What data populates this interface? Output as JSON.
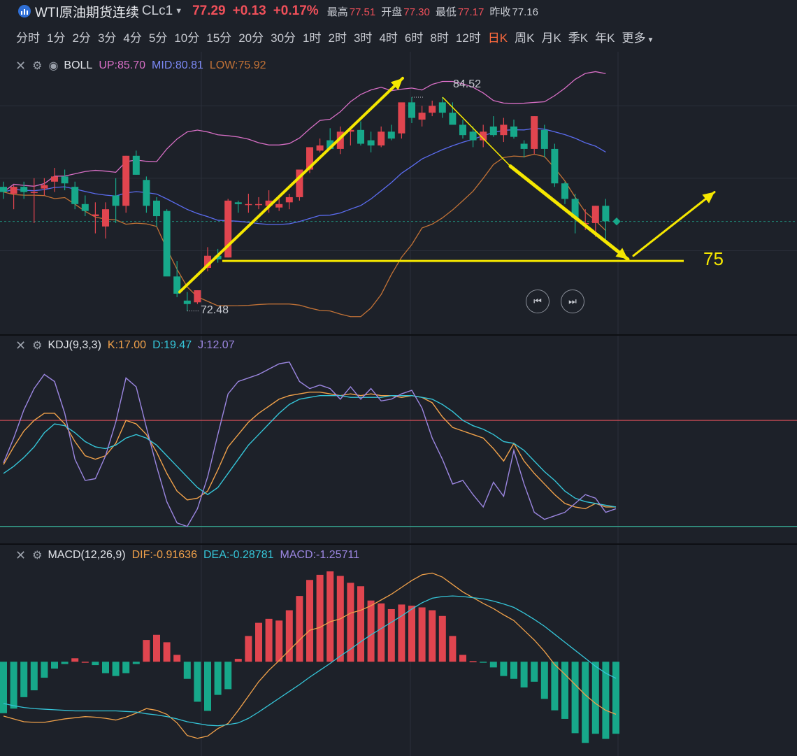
{
  "header": {
    "symbol": "WTI原油期货连续",
    "code": "CLc1",
    "price": "77.29",
    "change": "+0.13",
    "change_pct": "+0.17%",
    "stats": [
      {
        "label": "最高",
        "value": "77.51",
        "color": "red"
      },
      {
        "label": "开盘",
        "value": "77.30",
        "color": "red"
      },
      {
        "label": "最低",
        "value": "77.17",
        "color": "red"
      },
      {
        "label": "昨收",
        "value": "77.16",
        "color": "gray"
      }
    ]
  },
  "periods": [
    "分时",
    "1分",
    "2分",
    "3分",
    "4分",
    "5分",
    "10分",
    "15分",
    "20分",
    "30分",
    "1时",
    "2时",
    "3时",
    "4时",
    "6时",
    "8时",
    "12时",
    "日K",
    "周K",
    "月K",
    "季K",
    "年K",
    "更多"
  ],
  "active_period": "日K",
  "indicators": {
    "boll": {
      "name": "BOLL",
      "up": "UP:85.70",
      "mid": "MID:80.81",
      "low": "LOW:75.92"
    },
    "kdj": {
      "name": "KDJ(9,3,3)",
      "k": "K:17.00",
      "d": "D:19.47",
      "j": "J:12.07"
    },
    "macd": {
      "name": "MACD(12,26,9)",
      "dif": "DIF:-0.91636",
      "dea": "DEA:-0.28781",
      "macd": "MACD:-1.25711"
    }
  },
  "annotations": {
    "high_label": "84.52",
    "low_label": "72.48",
    "support_label": "75"
  },
  "colors": {
    "up": "#e0454f",
    "down": "#17a88a",
    "boll_up": "#d86fc6",
    "boll_mid": "#5b6cf0",
    "boll_low": "#c27236",
    "k": "#f0a14a",
    "d": "#35c5d8",
    "j": "#9b86e0",
    "arrow": "#f5e700"
  },
  "chart_data": [
    {
      "type": "candlestick",
      "title": "",
      "series": [
        {
          "name": "BOLL",
          "values": [
            [
              79.3,
              79.6,
              78.6,
              79.0
            ],
            [
              78.9,
              79.4,
              78.0,
              79.3
            ],
            [
              79.3,
              79.6,
              78.6,
              79.0
            ],
            [
              79.0,
              79.8,
              77.2,
              79.0
            ],
            [
              79.2,
              79.8,
              78.8,
              79.4
            ],
            [
              79.6,
              80.4,
              79.0,
              79.9
            ],
            [
              79.9,
              80.3,
              79.1,
              79.5
            ],
            [
              79.3,
              79.6,
              78.0,
              78.3
            ],
            [
              78.3,
              78.8,
              77.6,
              77.9
            ],
            [
              77.6,
              78.4,
              76.6,
              77.7
            ],
            [
              77.0,
              78.4,
              76.3,
              78.0
            ],
            [
              78.8,
              79.8,
              77.2,
              78.2
            ],
            [
              78.2,
              81.1,
              77.8,
              81.1
            ],
            [
              81.1,
              81.4,
              80.0,
              80.0
            ],
            [
              79.7,
              79.9,
              77.8,
              78.2
            ],
            [
              78.5,
              78.7,
              77.0,
              77.6
            ],
            [
              77.9,
              78.0,
              74.8,
              74.1
            ],
            [
              74.1,
              75.0,
              72.9,
              73.1
            ],
            [
              72.7,
              73.2,
              72.1,
              72.5
            ],
            [
              72.6,
              73.3,
              72.5,
              73.3
            ],
            [
              74.6,
              75.8,
              74.4,
              75.3
            ],
            [
              75.3,
              75.7,
              74.9,
              75.1
            ],
            [
              75.2,
              78.6,
              75.2,
              78.5
            ],
            [
              78.4,
              78.5,
              77.8,
              78.3
            ],
            [
              78.3,
              78.9,
              77.8,
              78.3
            ],
            [
              78.3,
              78.7,
              78.0,
              78.3
            ],
            [
              78.2,
              79.1,
              77.8,
              78.5
            ],
            [
              78.1,
              78.6,
              77.9,
              78.3
            ],
            [
              78.4,
              78.9,
              78.0,
              78.7
            ],
            [
              78.7,
              80.3,
              78.5,
              80.3
            ],
            [
              80.3,
              81.6,
              80.1,
              81.6
            ],
            [
              81.4,
              82.1,
              81.3,
              81.7
            ],
            [
              82.0,
              82.7,
              81.5,
              81.5
            ],
            [
              81.5,
              82.8,
              81.2,
              82.5
            ],
            [
              82.5,
              82.8,
              81.7,
              82.6
            ],
            [
              82.6,
              83.1,
              81.7,
              81.8
            ],
            [
              82.0,
              82.5,
              81.3,
              81.7
            ],
            [
              81.7,
              82.8,
              81.6,
              82.5
            ],
            [
              82.5,
              82.9,
              82.0,
              82.1
            ],
            [
              82.4,
              83.5,
              82.1,
              84.2
            ],
            [
              84.2,
              84.5,
              83.0,
              83.3
            ],
            [
              83.2,
              84.0,
              82.8,
              83.6
            ],
            [
              83.6,
              84.3,
              83.4,
              84.0
            ],
            [
              84.2,
              84.5,
              83.3,
              83.6
            ],
            [
              83.6,
              84.2,
              83.0,
              82.9
            ],
            [
              82.9,
              83.2,
              82.1,
              82.3
            ],
            [
              82.5,
              82.8,
              81.6,
              82.0
            ],
            [
              82.0,
              82.9,
              81.6,
              82.5
            ],
            [
              82.8,
              83.4,
              82.2,
              82.3
            ],
            [
              82.3,
              83.3,
              81.9,
              82.9
            ],
            [
              82.8,
              83.2,
              82.1,
              82.2
            ],
            [
              81.8,
              82.0,
              81.0,
              81.5
            ],
            [
              81.5,
              83.4,
              81.2,
              83.4
            ],
            [
              82.6,
              82.9,
              81.0,
              81.5
            ],
            [
              81.5,
              81.8,
              79.3,
              79.5
            ],
            [
              79.5,
              79.6,
              78.3,
              78.6
            ],
            [
              78.6,
              78.9,
              76.6,
              77.5
            ],
            [
              77.2,
              78.0,
              76.8,
              77.2
            ],
            [
              77.2,
              78.2,
              76.4,
              78.2
            ],
            [
              78.2,
              78.6,
              76.2,
              77.3
            ]
          ]
        }
      ],
      "ylim": [
        71.8,
        86.0
      ],
      "ylabel": "",
      "xlabel": ""
    },
    {
      "type": "line",
      "title": "",
      "series": [
        {
          "name": "K",
          "values": [
            55,
            65,
            74,
            80,
            84,
            84,
            78,
            68,
            60,
            58,
            60,
            67,
            80,
            78,
            72,
            62,
            50,
            40,
            35,
            36,
            40,
            52,
            65,
            72,
            79,
            84,
            88,
            92,
            94,
            95,
            96,
            96,
            95,
            94,
            95,
            94,
            95,
            94,
            94,
            93,
            94,
            93,
            90,
            82,
            76,
            74,
            72,
            70,
            64,
            57,
            67,
            57,
            50,
            44,
            38,
            33,
            31,
            30,
            33,
            31,
            31
          ]
        },
        {
          "name": "D",
          "values": [
            50,
            54,
            59,
            65,
            73,
            78,
            77,
            73,
            68,
            65,
            64,
            66,
            70,
            72,
            70,
            66,
            60,
            54,
            48,
            42,
            38,
            42,
            50,
            58,
            66,
            72,
            78,
            84,
            89,
            92,
            93,
            94,
            94,
            94,
            93,
            93,
            93,
            93,
            94,
            94,
            94,
            93,
            92,
            89,
            85,
            80,
            77,
            75,
            72,
            68,
            67,
            63,
            57,
            51,
            46,
            40,
            36,
            34,
            33,
            32,
            31
          ]
        },
        {
          "name": "J",
          "values": [
            56,
            70,
            86,
            98,
            106,
            102,
            84,
            58,
            46,
            47,
            60,
            79,
            104,
            99,
            76,
            54,
            34,
            22,
            20,
            30,
            48,
            72,
            95,
            102,
            104,
            106,
            109,
            112,
            113,
            102,
            98,
            100,
            98,
            92,
            99,
            92,
            98,
            91,
            92,
            95,
            97,
            87,
            70,
            58,
            44,
            46,
            38,
            31,
            45,
            37,
            63,
            44,
            28,
            24,
            26,
            28,
            33,
            38,
            36,
            28,
            30
          ]
        }
      ],
      "ylim": [
        10,
        120
      ]
    },
    {
      "type": "bar",
      "title": "",
      "series": [
        {
          "name": "MACD",
          "values": [
            -0.9,
            -0.82,
            -0.62,
            -0.5,
            -0.28,
            -0.12,
            -0.04,
            0.06,
            0.0,
            -0.06,
            -0.2,
            -0.25,
            -0.2,
            -0.04,
            0.38,
            0.47,
            0.34,
            0.12,
            -0.3,
            -0.7,
            -0.86,
            -0.58,
            -0.48,
            0.05,
            0.45,
            0.68,
            0.75,
            0.72,
            0.9,
            1.15,
            1.43,
            1.52,
            1.58,
            1.5,
            1.38,
            1.32,
            1.07,
            1.02,
            0.92,
            1.0,
            0.98,
            0.95,
            0.9,
            0.8,
            0.45,
            0.12,
            0.01,
            -0.01,
            -0.1,
            -0.25,
            -0.3,
            -0.45,
            -0.35,
            -0.65,
            -0.85,
            -1.0,
            -1.25,
            -1.42,
            -1.26,
            -1.35,
            -1.26
          ]
        },
        {
          "name": "DIF",
          "values": [
            -0.95,
            -1.0,
            -1.05,
            -1.06,
            -1.06,
            -1.03,
            -1.0,
            -0.98,
            -0.96,
            -0.97,
            -0.99,
            -1.02,
            -0.97,
            -0.9,
            -0.82,
            -0.85,
            -0.92,
            -1.07,
            -1.29,
            -1.34,
            -1.3,
            -1.17,
            -1.08,
            -0.85,
            -0.6,
            -0.35,
            -0.15,
            0.02,
            0.2,
            0.38,
            0.55,
            0.6,
            0.7,
            0.75,
            0.85,
            0.9,
            0.98,
            1.08,
            1.18,
            1.3,
            1.42,
            1.52,
            1.55,
            1.48,
            1.35,
            1.22,
            1.12,
            1.02,
            0.93,
            0.82,
            0.72,
            0.55,
            0.38,
            0.18,
            -0.05,
            -0.22,
            -0.4,
            -0.58,
            -0.73,
            -0.85,
            -0.92
          ]
        },
        {
          "name": "DEA",
          "values": [
            -0.73,
            -0.77,
            -0.8,
            -0.82,
            -0.83,
            -0.84,
            -0.85,
            -0.86,
            -0.86,
            -0.86,
            -0.86,
            -0.86,
            -0.87,
            -0.88,
            -0.91,
            -0.93,
            -0.96,
            -1.0,
            -1.05,
            -1.08,
            -1.11,
            -1.12,
            -1.1,
            -1.07,
            -0.99,
            -0.88,
            -0.76,
            -0.64,
            -0.52,
            -0.4,
            -0.27,
            -0.15,
            -0.03,
            0.1,
            0.22,
            0.35,
            0.47,
            0.58,
            0.69,
            0.8,
            0.92,
            1.03,
            1.11,
            1.14,
            1.15,
            1.14,
            1.12,
            1.1,
            1.06,
            1.01,
            0.95,
            0.85,
            0.74,
            0.62,
            0.48,
            0.34,
            0.2,
            0.06,
            -0.08,
            -0.2,
            -0.29
          ]
        }
      ],
      "ylim": [
        -1.6,
        1.8
      ]
    }
  ]
}
